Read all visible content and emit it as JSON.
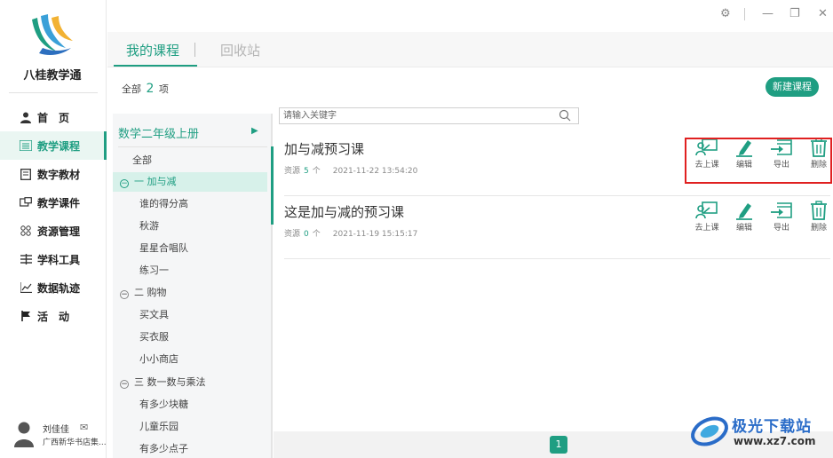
{
  "app": {
    "brand": "八桂教学通"
  },
  "sidebar": {
    "items": [
      {
        "label": "首　页",
        "icon": "user-icon"
      },
      {
        "label": "教学课程",
        "icon": "list-icon",
        "active": true
      },
      {
        "label": "数字教材",
        "icon": "book-icon"
      },
      {
        "label": "教学课件",
        "icon": "courseware-icon"
      },
      {
        "label": "资源管理",
        "icon": "grid-icon"
      },
      {
        "label": "学科工具",
        "icon": "tools-icon"
      },
      {
        "label": "数据轨迹",
        "icon": "chart-icon"
      },
      {
        "label": "活　动",
        "icon": "flag-icon"
      }
    ],
    "user": {
      "name": "刘佳佳",
      "org": "广西新华书店集..."
    }
  },
  "tabs": [
    {
      "label": "我的课程"
    },
    {
      "label": "回收站"
    }
  ],
  "summary": {
    "prefix": "全部",
    "count": "2",
    "suffix": "项"
  },
  "new_course_label": "新建课程",
  "tree": {
    "book": "数学二年级上册",
    "items": [
      {
        "label": "全部",
        "kind": "top"
      },
      {
        "label": "一 加与减",
        "kind": "unit",
        "selected": true
      },
      {
        "label": "谁的得分高",
        "kind": "leaf"
      },
      {
        "label": "秋游",
        "kind": "leaf"
      },
      {
        "label": "星星合唱队",
        "kind": "leaf"
      },
      {
        "label": "练习一",
        "kind": "leaf"
      },
      {
        "label": "二 购物",
        "kind": "unit"
      },
      {
        "label": "买文具",
        "kind": "leaf"
      },
      {
        "label": "买衣服",
        "kind": "leaf"
      },
      {
        "label": "小小商店",
        "kind": "leaf"
      },
      {
        "label": "三 数一数与乘法",
        "kind": "unit"
      },
      {
        "label": "有多少块糖",
        "kind": "leaf"
      },
      {
        "label": "儿童乐园",
        "kind": "leaf"
      },
      {
        "label": "有多少点子",
        "kind": "leaf"
      }
    ]
  },
  "search": {
    "placeholder": "请输入关键字",
    "value": ""
  },
  "courses": [
    {
      "title": "加与减预习课",
      "res_label": "资源",
      "res_count": "5",
      "res_unit": "个",
      "time": "2021-11-22 13:54:20"
    },
    {
      "title": "这是加与减的预习课",
      "res_label": "资源",
      "res_count": "0",
      "res_unit": "个",
      "time": "2021-11-19 15:15:17"
    }
  ],
  "actions": {
    "teach": "去上课",
    "edit": "编辑",
    "export": "导出",
    "delete": "删除"
  },
  "pager": {
    "current": "1"
  },
  "watermark": {
    "name": "极光下载站",
    "url": "www.xz7.com"
  },
  "colors": {
    "accent": "#1f9e82",
    "highlight": "#e02020"
  }
}
